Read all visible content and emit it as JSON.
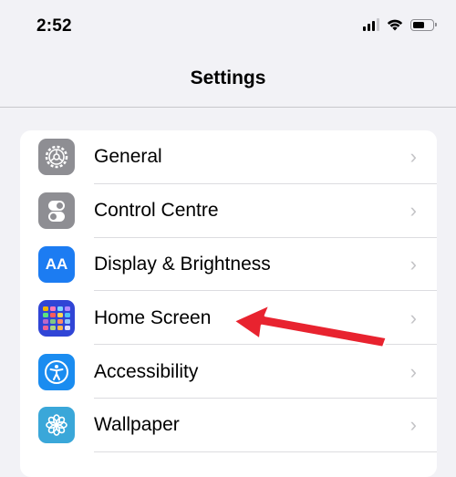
{
  "status_bar": {
    "time": "2:52"
  },
  "nav": {
    "title": "Settings"
  },
  "rows": [
    {
      "label": "General",
      "icon": "gear-icon",
      "chevron": "›"
    },
    {
      "label": "Control Centre",
      "icon": "toggles-icon",
      "chevron": "›"
    },
    {
      "label": "Display & Brightness",
      "icon": "text-size-icon",
      "icon_text": "AA",
      "chevron": "›"
    },
    {
      "label": "Home Screen",
      "icon": "home-screen-grid-icon",
      "chevron": "›"
    },
    {
      "label": "Accessibility",
      "icon": "accessibility-person-icon",
      "chevron": "›"
    },
    {
      "label": "Wallpaper",
      "icon": "flower-icon",
      "chevron": "›"
    }
  ],
  "annotation": {
    "type": "red arrow pointing to Home Screen",
    "color": "#e8232f"
  },
  "colors": {
    "background": "#f2f2f6",
    "card": "#ffffff",
    "accent_blue": "#1c7cf2"
  }
}
